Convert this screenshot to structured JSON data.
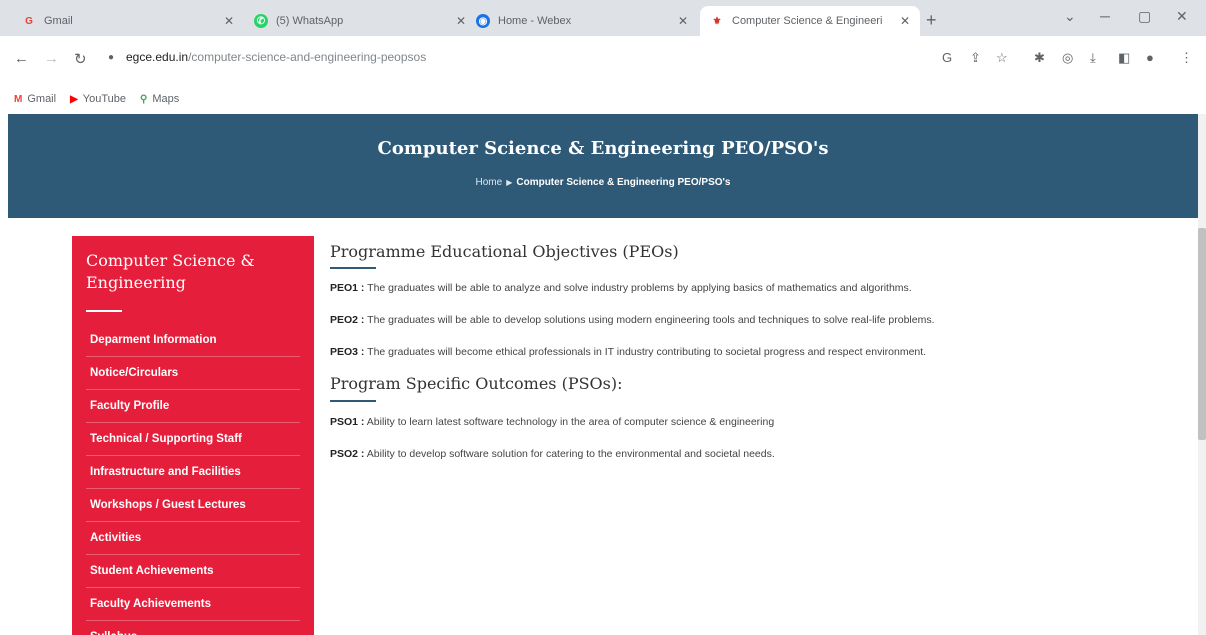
{
  "browser": {
    "tabs": [
      {
        "title": "Gmail",
        "icon": "gmail-icon"
      },
      {
        "title": "(5) WhatsApp",
        "icon": "whatsapp-icon"
      },
      {
        "title": "Home - Webex",
        "icon": "webex-icon"
      },
      {
        "title": "Computer Science & Engineeri",
        "icon": "college-icon"
      }
    ],
    "address": {
      "host": "egce.edu.in",
      "path": "/computer-science-and-engineering-peopsos"
    },
    "bookmarks": [
      {
        "label": "Gmail",
        "icon": "gmail-icon"
      },
      {
        "label": "YouTube",
        "icon": "youtube-icon"
      },
      {
        "label": "Maps",
        "icon": "maps-icon"
      }
    ]
  },
  "banner": {
    "title": "Computer Science & Engineering PEO/PSO's",
    "breadcrumb": {
      "home": "Home",
      "current": "Computer Science & Engineering PEO/PSO's"
    }
  },
  "sidebar": {
    "title": "Computer Science & Engineering",
    "items": [
      "Deparment Information",
      "Notice/Circulars",
      "Faculty Profile",
      "Technical / Supporting Staff",
      "Infrastructure and Facilities",
      "Workshops / Guest Lectures",
      "Activities",
      "Student Achievements",
      "Faculty Achievements",
      "Syllabus"
    ]
  },
  "content": {
    "peo_heading": "Programme Educational Objectives (PEOs)",
    "peos": [
      {
        "code": "PEO1 :",
        "text": "The graduates will be able to analyze and solve industry problems by applying basics of mathematics and algorithms."
      },
      {
        "code": "PEO2 :",
        "text": "The graduates will be able to develop solutions using modern engineering tools and techniques to solve real-life problems."
      },
      {
        "code": "PEO3 :",
        "text": "The graduates will become ethical professionals in IT industry contributing to societal progress and respect environment."
      }
    ],
    "pso_heading": "Program Specific Outcomes (PSOs):",
    "psos": [
      {
        "code": "PSO1 :",
        "text": "Ability to learn latest software technology in the area of computer science & engineering"
      },
      {
        "code": "PSO2 :",
        "text": "Ability to develop software solution for catering to the environmental and societal needs."
      }
    ]
  },
  "colors": {
    "banner": "#2e5a78",
    "sidebar": "#e51f3b",
    "tabstrip": "#dee1e6"
  }
}
